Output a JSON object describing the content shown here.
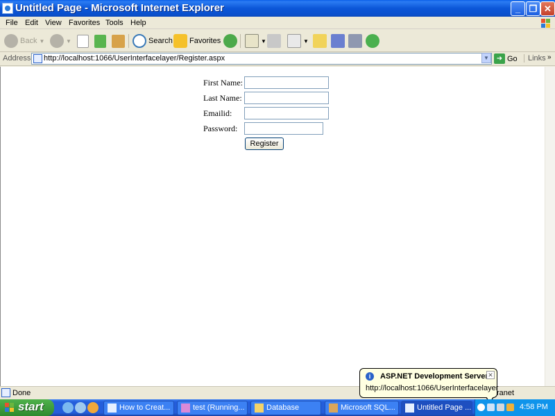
{
  "window": {
    "title": "Untitled Page - Microsoft Internet Explorer"
  },
  "menu": [
    "File",
    "Edit",
    "View",
    "Favorites",
    "Tools",
    "Help"
  ],
  "toolbar": {
    "back": "Back",
    "search": "Search",
    "favorites": "Favorites"
  },
  "address": {
    "label": "Address",
    "url": "http://localhost:1066/UserInterfacelayer/Register.aspx",
    "go": "Go",
    "links": "Links"
  },
  "form": {
    "first_name": "First Name:",
    "last_name": "Last Name:",
    "email": "Emailid:",
    "password": "Password:",
    "register": "Register"
  },
  "status": {
    "text": "Done",
    "zone": "ranet"
  },
  "balloon": {
    "title": "ASP.NET Development Server",
    "text": "http://localhost:1066/UserInterfacelayer"
  },
  "taskbar": {
    "start": "start",
    "tasks": [
      "How to Creat...",
      "test (Running...",
      "Database",
      "Microsoft SQL...",
      "Untitled Page ..."
    ],
    "clock": "4:58 PM"
  }
}
